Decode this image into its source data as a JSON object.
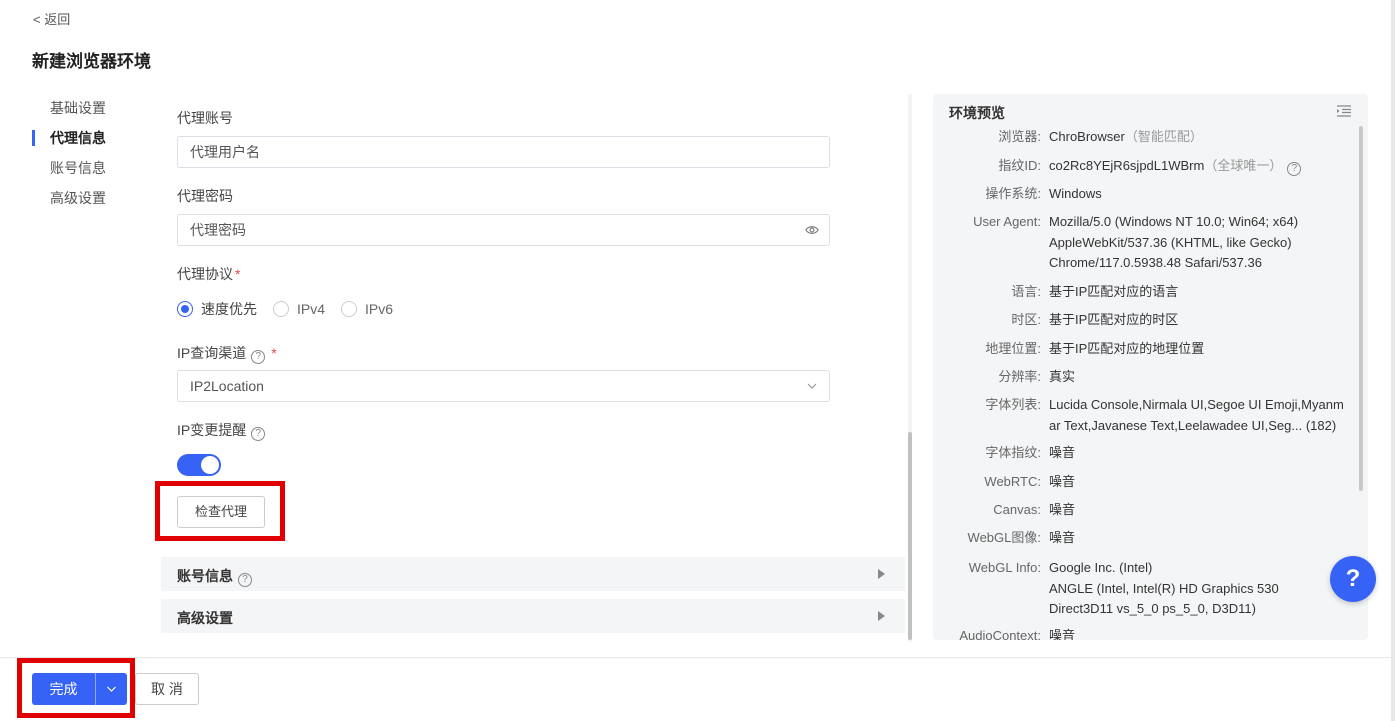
{
  "header": {
    "back_label": "< 返回",
    "title": "新建浏览器环境"
  },
  "nav": {
    "items": [
      "基础设置",
      "代理信息",
      "账号信息",
      "高级设置"
    ],
    "active": "代理信息"
  },
  "form": {
    "proxy_account": {
      "label": "代理账号",
      "placeholder": "代理用户名"
    },
    "proxy_password": {
      "label": "代理密码",
      "placeholder": "代理密码"
    },
    "proxy_protocol": {
      "label": "代理协议",
      "required": "*",
      "options": [
        "速度优先",
        "IPv4",
        "IPv6"
      ],
      "selected": "速度优先"
    },
    "ip_channel": {
      "label": "IP查询渠道",
      "required": "*",
      "value": "IP2Location"
    },
    "ip_change_alert": {
      "label": "IP变更提醒",
      "enabled": true
    },
    "check_proxy_label": "检查代理",
    "sections": [
      "账号信息",
      "高级设置"
    ]
  },
  "preview": {
    "title": "环境预览",
    "rows": [
      {
        "key": "浏览器:",
        "value": "ChroBrowser",
        "hint": "（智能匹配）"
      },
      {
        "key": "指纹ID:",
        "value": "co2Rc8YEjR6sjpdL1WBrm",
        "hint": "（全球唯一）"
      },
      {
        "key": "操作系统:",
        "value": "Windows"
      },
      {
        "key": "User Agent:",
        "value": "Mozilla/5.0 (Windows NT 10.0; Win64; x64) AppleWebKit/537.36 (KHTML, like Gecko) Chrome/117.0.5938.48 Safari/537.36"
      },
      {
        "key": "语言:",
        "value": "基于IP匹配对应的语言"
      },
      {
        "key": "时区:",
        "value": "基于IP匹配对应的时区"
      },
      {
        "key": "地理位置:",
        "value": "基于IP匹配对应的地理位置"
      },
      {
        "key": "分辨率:",
        "value": "真实"
      },
      {
        "key": "字体列表:",
        "value": "Lucida Console,Nirmala UI,Segoe UI Emoji,Myanmar Text,Javanese Text,Leelawadee UI,Seg...",
        "count": "(182)"
      },
      {
        "key": "字体指纹:",
        "value": "噪音"
      },
      {
        "key": "WebRTC:",
        "value": "噪音"
      },
      {
        "key": "Canvas:",
        "value": "噪音"
      },
      {
        "key": "WebGL图像:",
        "value": "噪音"
      },
      {
        "key": "WebGL Info:",
        "value": "Google Inc. (Intel)",
        "value2": "ANGLE (Intel, Intel(R) HD Graphics 530 Direct3D11 vs_5_0 ps_5_0, D3D11)"
      },
      {
        "key": "AudioContext:",
        "value": "噪音"
      }
    ]
  },
  "help_label": "?",
  "footer": {
    "done_label": "完成",
    "cancel_label": "取 消"
  },
  "colors": {
    "primary": "#3662f5",
    "highlight": "#e00000",
    "panel_bg": "#f4f5f7"
  },
  "icons": [
    "eye-icon",
    "chevron-down-icon",
    "question-icon",
    "caret-right-icon",
    "list-menu-icon"
  ]
}
